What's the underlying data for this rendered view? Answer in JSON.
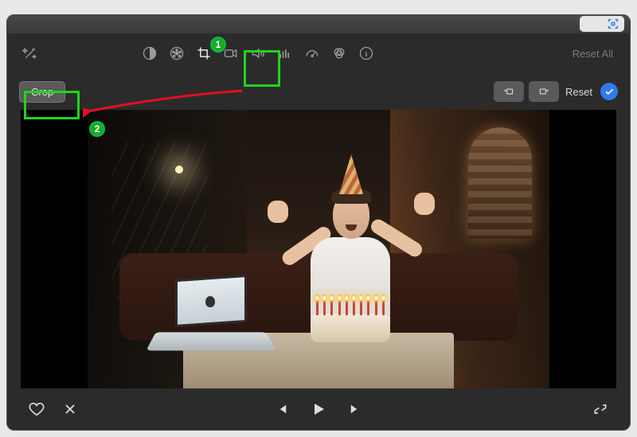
{
  "titlebar": {
    "scan_icon": "scan-icon"
  },
  "toolbar": {
    "wand": "magic-wand-icon",
    "items": [
      {
        "name": "color-balance-icon"
      },
      {
        "name": "color-palette-icon"
      },
      {
        "name": "crop-icon",
        "active": true
      },
      {
        "name": "video-camera-icon"
      },
      {
        "name": "volume-icon"
      },
      {
        "name": "equalizer-icon"
      },
      {
        "name": "speedometer-icon"
      },
      {
        "name": "color-filter-icon"
      },
      {
        "name": "info-icon"
      }
    ],
    "reset_all_label": "Reset All"
  },
  "subbar": {
    "crop_label": "Crop",
    "rotate_ccw": "rotate-ccw-icon",
    "rotate_cw": "rotate-cw-icon",
    "reset_label": "Reset",
    "confirm": "check-icon"
  },
  "controls": {
    "favorite": "heart-icon",
    "reject": "x-icon",
    "prev": "skip-back-icon",
    "play": "play-icon",
    "next": "skip-forward-icon",
    "fullscreen": "expand-icon"
  },
  "annotations": {
    "step1": "1",
    "step2": "2"
  },
  "colors": {
    "accent": "#2f7bea",
    "annotation": "#1fd41f",
    "arrow": "#e01020"
  }
}
